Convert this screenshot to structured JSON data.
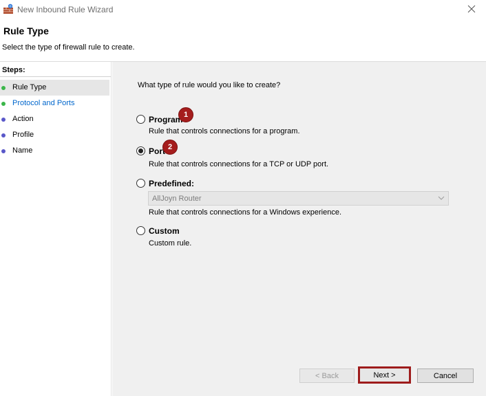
{
  "window": {
    "title": "New Inbound Rule Wizard"
  },
  "header": {
    "title": "Rule Type",
    "subtitle": "Select the type of firewall rule to create."
  },
  "steps": {
    "heading": "Steps:",
    "items": [
      {
        "label": "Rule Type",
        "state": "current",
        "dot_color": "#3bb64a"
      },
      {
        "label": "Protocol and Ports",
        "state": "link",
        "dot_color": "#3bb64a"
      },
      {
        "label": "Action",
        "state": "pending",
        "dot_color": "#5a58c9"
      },
      {
        "label": "Profile",
        "state": "pending",
        "dot_color": "#5a58c9"
      },
      {
        "label": "Name",
        "state": "pending",
        "dot_color": "#5a58c9"
      }
    ]
  },
  "content": {
    "question": "What type of rule would you like to create?",
    "options": [
      {
        "label": "Program",
        "description": "Rule that controls connections for a program.",
        "checked": false,
        "badge": "1"
      },
      {
        "label": "Port",
        "description": "Rule that controls connections for a TCP or UDP port.",
        "checked": true,
        "badge": "2"
      },
      {
        "label": "Predefined:",
        "description": "Rule that controls connections for a Windows experience.",
        "checked": false
      },
      {
        "label": "Custom",
        "description": "Custom rule.",
        "checked": false
      }
    ],
    "predefined_dropdown": {
      "value": "AllJoyn Router",
      "disabled": true
    }
  },
  "buttons": {
    "back": "< Back",
    "next": "Next >",
    "cancel": "Cancel"
  },
  "colors": {
    "badge": "#a51d1d",
    "highlight": "#9e1c1c",
    "link": "#0066cc"
  }
}
